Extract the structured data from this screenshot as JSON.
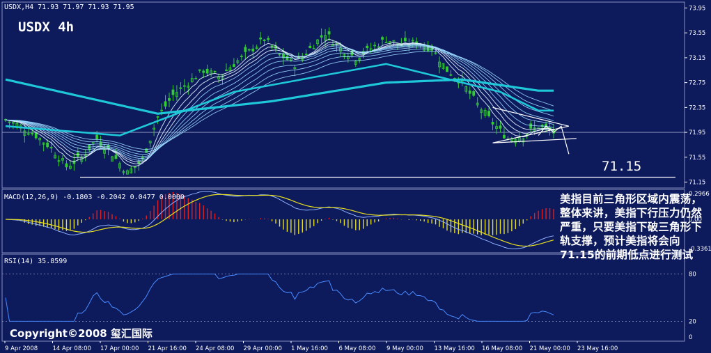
{
  "header": {
    "price_info": "USDX,H4  71.93 71.97 71.93 71.95",
    "symbol_label": "USDX 4h",
    "macd_info": "MACD(12,26,9) -0.1803 -0.2042 0.0477 0.0000",
    "rsi_info": "RSI(14) 35.8599"
  },
  "annotation_level": "71.15",
  "copyright": "Copyright©2008 玺汇国际",
  "commentary": "美指目前三角形区域内震荡，整体来讲，美指下行压力仍然严重，只要美指下破三角形下轨支撑，预计美指将会向71.15的前期低点进行测试",
  "colors": {
    "background": "#0d1a5c",
    "candle": "#33cc33",
    "ma_slow": "#1fc8d8",
    "ma_fast": "#9ad8ff",
    "macd_up": "#e02020",
    "macd_down": "#e8e020",
    "signal_line": "#e8e020",
    "rsi_line": "#4a8cff"
  },
  "chart_data": [
    {
      "type": "candlestick",
      "title": "USDX,H4",
      "y_ticks": [
        "73.95",
        "73.55",
        "73.15",
        "72.75",
        "72.35",
        "71.95",
        "71.55",
        "71.15"
      ],
      "ylim": [
        71.1,
        74.0
      ],
      "x_ticks": [
        "9 Apr 2008",
        "14 Apr 08:00",
        "17 Apr 00:00",
        "21 Apr 16:00",
        "24 Apr 08:00",
        "29 Apr 00:00",
        "1 May 16:00",
        "6 May 08:00",
        "9 May 00:00",
        "13 May 16:00",
        "16 May 08:00",
        "21 May 00:00",
        "23 May 16:00"
      ],
      "close_path": [
        [
          0,
          72.15
        ],
        [
          4,
          72.05
        ],
        [
          8,
          71.9
        ],
        [
          12,
          71.7
        ],
        [
          16,
          71.4
        ],
        [
          20,
          71.55
        ],
        [
          24,
          71.85
        ],
        [
          28,
          71.6
        ],
        [
          32,
          71.3
        ],
        [
          36,
          71.5
        ],
        [
          40,
          72.2
        ],
        [
          44,
          72.55
        ],
        [
          48,
          72.75
        ],
        [
          52,
          72.95
        ],
        [
          56,
          72.85
        ],
        [
          60,
          73.05
        ],
        [
          64,
          73.25
        ],
        [
          68,
          73.45
        ],
        [
          72,
          73.2
        ],
        [
          76,
          73.05
        ],
        [
          80,
          73.3
        ],
        [
          84,
          73.55
        ],
        [
          88,
          73.3
        ],
        [
          92,
          73.15
        ],
        [
          96,
          73.3
        ],
        [
          100,
          73.45
        ],
        [
          104,
          73.35
        ],
        [
          108,
          73.4
        ],
        [
          112,
          73.3
        ],
        [
          116,
          72.95
        ],
        [
          120,
          72.75
        ],
        [
          124,
          72.4
        ],
        [
          128,
          72.1
        ],
        [
          132,
          71.85
        ],
        [
          136,
          71.9
        ],
        [
          140,
          72.05
        ],
        [
          144,
          71.95
        ]
      ],
      "moving_averages": [
        {
          "name": "slow_200",
          "values": [
            [
              0,
              72.8
            ],
            [
              40,
              72.25
            ],
            [
              70,
              72.45
            ],
            [
              100,
              72.75
            ],
            [
              120,
              72.8
            ],
            [
              140,
              72.62
            ]
          ]
        },
        {
          "name": "mid_100",
          "values": [
            [
              0,
              72.05
            ],
            [
              30,
              71.9
            ],
            [
              60,
              72.6
            ],
            [
              100,
              73.05
            ],
            [
              130,
              72.6
            ],
            [
              140,
              72.3
            ]
          ]
        }
      ],
      "annotation": {
        "label": "71.15",
        "support_level": 71.15,
        "current": 71.95
      }
    },
    {
      "type": "bar",
      "title": "MACD(12,26,9)",
      "values": {
        "macd": -0.1803,
        "signal": -0.2042,
        "histogram": 0.0477,
        "extra": 0.0
      },
      "y_ticks": [
        "0.2966",
        "0.00",
        "-0.3361"
      ],
      "ylim": [
        -0.3361,
        0.2966
      ]
    },
    {
      "type": "line",
      "title": "RSI(14)",
      "values": {
        "current": 35.8599
      },
      "y_ticks": [
        "80",
        "20",
        "0"
      ],
      "ylim": [
        0,
        100
      ]
    }
  ]
}
